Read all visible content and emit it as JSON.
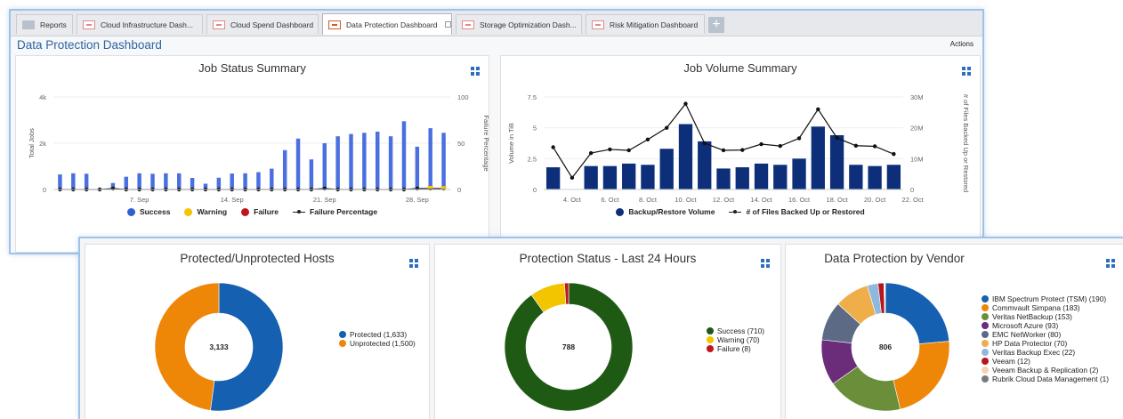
{
  "tabs": [
    {
      "label": "Reports",
      "icon": "reports-icon"
    },
    {
      "label": "Cloud Infrastructure Dash...",
      "icon": "dashboard-icon"
    },
    {
      "label": "Cloud Spend Dashboard",
      "icon": "dashboard-icon"
    },
    {
      "label": "Data Protection Dashboard",
      "icon": "dashboard-icon",
      "active": true
    },
    {
      "label": "Storage Optimization Dash...",
      "icon": "dashboard-icon"
    },
    {
      "label": "Risk Mitigation Dashboard",
      "icon": "dashboard-icon"
    }
  ],
  "add_tab_label": "+",
  "dashboard_title": "Data Protection Dashboard",
  "actions_label": "Actions",
  "colors": {
    "accent": "#2b63a6",
    "bar_blue": "#4a6fe0",
    "navy": "#0d2f7a",
    "success_green": "#1f5a14",
    "warning_yellow": "#f2c500",
    "failure_red": "#c0161b",
    "protected_blue": "#1560b0",
    "unprotected_orange": "#ee8608"
  },
  "chart_data": [
    {
      "type": "bar",
      "title": "Job Status Summary",
      "ylabel": "Total Jobs",
      "y2label": "Failure Percentage",
      "ylim": [
        0,
        4000
      ],
      "y2lim": [
        0,
        100
      ],
      "yticks": [
        "4k",
        "2k",
        "0"
      ],
      "y2ticks": [
        "100",
        "50",
        "0"
      ],
      "xticks": [
        "7. Sep",
        "14. Sep",
        "21. Sep",
        "28. Sep"
      ],
      "x": [
        "1. Sep",
        "2. Sep",
        "3. Sep",
        "4. Sep",
        "5. Sep",
        "6. Sep",
        "7. Sep",
        "8. Sep",
        "9. Sep",
        "10. Sep",
        "11. Sep",
        "12. Sep",
        "13. Sep",
        "14. Sep",
        "15. Sep",
        "16. Sep",
        "17. Sep",
        "18. Sep",
        "19. Sep",
        "20. Sep",
        "21. Sep",
        "22. Sep",
        "23. Sep",
        "24. Sep",
        "25. Sep",
        "26. Sep",
        "27. Sep",
        "28. Sep",
        "29. Sep",
        "30. Sep"
      ],
      "series": [
        {
          "name": "Success",
          "values": [
            650,
            700,
            680,
            60,
            280,
            550,
            700,
            680,
            700,
            700,
            500,
            250,
            510,
            690,
            700,
            750,
            900,
            1700,
            2200,
            1300,
            2000,
            2300,
            2400,
            2450,
            2500,
            2300,
            2950,
            1850,
            2650,
            2450
          ]
        },
        {
          "name": "Warning",
          "values": [
            0,
            0,
            0,
            0,
            0,
            0,
            0,
            0,
            0,
            0,
            0,
            0,
            0,
            0,
            0,
            0,
            0,
            0,
            0,
            0,
            0,
            0,
            0,
            0,
            0,
            0,
            0,
            0,
            40,
            30
          ]
        },
        {
          "name": "Failure",
          "values": [
            0,
            0,
            0,
            0,
            0,
            0,
            0,
            0,
            0,
            0,
            0,
            0,
            0,
            0,
            0,
            0,
            0,
            0,
            0,
            0,
            0,
            0,
            0,
            0,
            0,
            0,
            0,
            0,
            0,
            0
          ]
        },
        {
          "name": "Failure Percentage",
          "type": "line",
          "values": [
            0,
            0,
            0,
            0,
            1,
            0,
            0,
            0,
            0,
            0,
            0,
            0,
            0,
            0,
            0,
            0,
            0,
            0,
            0,
            0,
            1,
            0,
            0,
            0,
            0,
            0,
            0,
            1,
            1,
            1
          ]
        }
      ],
      "legend": [
        "Success",
        "Warning",
        "Failure",
        "Failure Percentage"
      ],
      "legend_position": "bottom"
    },
    {
      "type": "bar",
      "title": "Job Volume Summary",
      "ylabel": "Volume in TiB",
      "y2label": "# of Files Backed Up or Restored",
      "ylim": [
        0,
        7.5
      ],
      "y2lim": [
        0,
        30000000
      ],
      "yticks": [
        "7.5",
        "5",
        "2.5",
        "0"
      ],
      "y2ticks": [
        "30M",
        "20M",
        "10M",
        "0"
      ],
      "xticks": [
        "4. Oct",
        "6. Oct",
        "8. Oct",
        "10. Oct",
        "12. Oct",
        "14. Oct",
        "16. Oct",
        "18. Oct",
        "20. Oct",
        "22. Oct"
      ],
      "x": [
        "3. Oct",
        "4. Oct",
        "5. Oct",
        "6. Oct",
        "7. Oct",
        "8. Oct",
        "9. Oct",
        "10. Oct",
        "11. Oct",
        "12. Oct",
        "13. Oct",
        "14. Oct",
        "15. Oct",
        "16. Oct",
        "17. Oct",
        "18. Oct",
        "19. Oct",
        "20. Oct",
        "21. Oct"
      ],
      "series": [
        {
          "name": "Backup/Restore Volume",
          "values": [
            1.8,
            0,
            1.9,
            1.9,
            2.1,
            2.0,
            3.3,
            5.3,
            3.9,
            1.7,
            1.8,
            2.1,
            2.0,
            2.5,
            5.1,
            4.4,
            2.0,
            1.9,
            2.0
          ]
        },
        {
          "name": "# of Files Backed Up or Restored",
          "type": "line",
          "values": [
            13700000,
            3800000,
            11800000,
            13000000,
            12700000,
            16200000,
            20000000,
            27800000,
            15000000,
            12700000,
            12800000,
            14700000,
            14100000,
            16600000,
            26000000,
            16700000,
            14200000,
            14000000,
            11500000
          ]
        }
      ],
      "legend": [
        "Backup/Restore Volume",
        "# of Files Backed Up or Restored"
      ],
      "legend_position": "bottom"
    },
    {
      "type": "pie",
      "title": "Protected/Unprotected Hosts",
      "center_label": "3,133",
      "slices": [
        {
          "label": "Protected (1,633)",
          "value": 1633,
          "color": "#1560b0"
        },
        {
          "label": "Unprotected (1,500)",
          "value": 1500,
          "color": "#ee8608"
        }
      ],
      "legend_position": "right"
    },
    {
      "type": "pie",
      "title": "Protection Status - Last 24 Hours",
      "center_label": "788",
      "slices": [
        {
          "label": "Success (710)",
          "value": 710,
          "color": "#1f5a14"
        },
        {
          "label": "Warning (70)",
          "value": 70,
          "color": "#f2c500"
        },
        {
          "label": "Failure (8)",
          "value": 8,
          "color": "#c0161b"
        }
      ],
      "legend_position": "right"
    },
    {
      "type": "pie",
      "title": "Data Protection by Vendor",
      "center_label": "806",
      "slices": [
        {
          "label": "IBM Spectrum Protect (TSM) (190)",
          "value": 190,
          "color": "#1560b0"
        },
        {
          "label": "Commvault Simpana (183)",
          "value": 183,
          "color": "#ee8608"
        },
        {
          "label": "Veritas NetBackup (153)",
          "value": 153,
          "color": "#6a8e3a"
        },
        {
          "label": "Microsoft Azure (93)",
          "value": 93,
          "color": "#6b2c7a"
        },
        {
          "label": "EMC NetWorker (80)",
          "value": 80,
          "color": "#5c6a86"
        },
        {
          "label": "HP Data Protector (70)",
          "value": 70,
          "color": "#efae4a"
        },
        {
          "label": "Veritas Backup Exec (22)",
          "value": 22,
          "color": "#8fb8df"
        },
        {
          "label": "Veeam (12)",
          "value": 12,
          "color": "#b5161d"
        },
        {
          "label": "Veeam Backup & Replication (2)",
          "value": 2,
          "color": "#f3d3b3"
        },
        {
          "label": "Rubrik Cloud Data Management (1)",
          "value": 1,
          "color": "#7a7a7a"
        }
      ],
      "legend_position": "right"
    }
  ]
}
